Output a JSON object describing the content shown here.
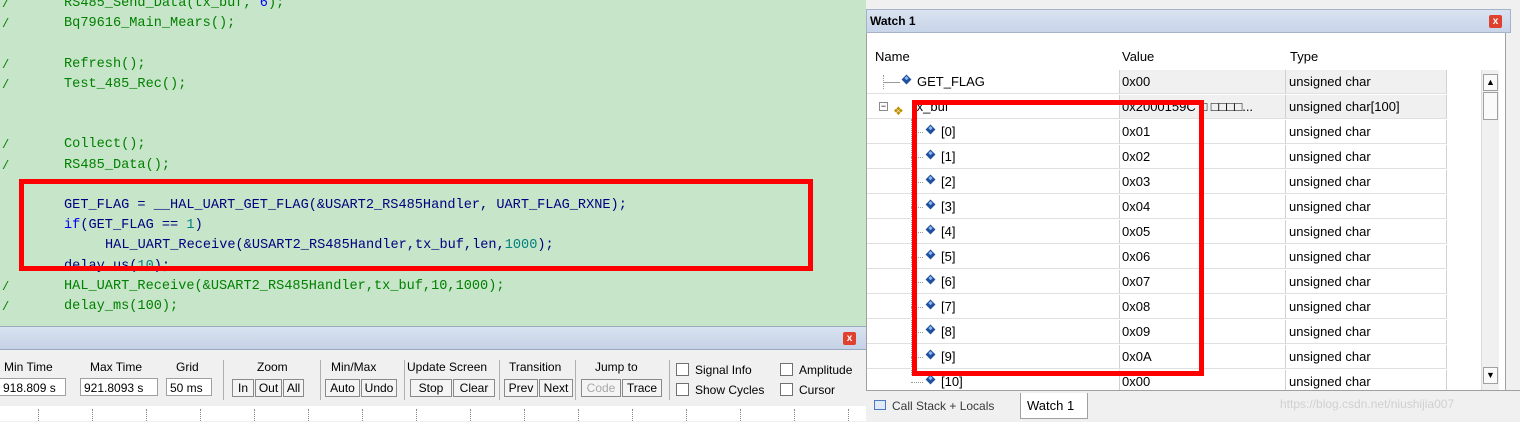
{
  "editor": {
    "lines": [
      {
        "mark": "/",
        "parts": [
          {
            "t": "RS485_Send_Data(tx_buf, "
          },
          {
            "t": "6",
            "c": "num"
          },
          {
            "t": ");"
          }
        ]
      },
      {
        "mark": "/",
        "parts": [
          {
            "t": "Bq79616_Main_Mears();"
          }
        ]
      },
      {
        "mark": "",
        "parts": []
      },
      {
        "mark": "/",
        "parts": [
          {
            "t": "Refresh();"
          }
        ]
      },
      {
        "mark": "/",
        "parts": [
          {
            "t": "Test_485_Rec();"
          }
        ]
      },
      {
        "mark": "",
        "parts": []
      },
      {
        "mark": "",
        "parts": []
      },
      {
        "mark": "/",
        "parts": [
          {
            "t": "Collect();"
          }
        ]
      },
      {
        "mark": "/",
        "parts": [
          {
            "t": "RS485_Data();"
          }
        ]
      },
      {
        "mark": "",
        "parts": []
      },
      {
        "mark": "",
        "active": true,
        "parts": [
          {
            "t": "GET_FLAG = __HAL_UART_GET_FLAG(&USART2_RS485Handler, UART_FLAG_RXNE);"
          }
        ]
      },
      {
        "mark": "",
        "active": true,
        "parts": [
          {
            "t": "if",
            "c": "kw"
          },
          {
            "t": "(GET_FLAG == "
          },
          {
            "t": "1",
            "c": "num"
          },
          {
            "t": ")"
          }
        ]
      },
      {
        "mark": "",
        "active": true,
        "indent": 1,
        "parts": [
          {
            "t": "HAL_UART_Receive(&USART2_RS485Handler,tx_buf,len,"
          },
          {
            "t": "1000",
            "c": "num"
          },
          {
            "t": ");"
          }
        ]
      },
      {
        "mark": "",
        "active": true,
        "parts": [
          {
            "t": "delay_us("
          },
          {
            "t": "10",
            "c": "num"
          },
          {
            "t": ");"
          }
        ]
      },
      {
        "mark": "/",
        "parts": [
          {
            "t": "HAL_UART_Receive(&USART2_RS485Handler,tx_buf,10,1000);"
          }
        ]
      },
      {
        "mark": "/",
        "parts": [
          {
            "t": "delay_ms(100);"
          }
        ]
      }
    ]
  },
  "analyzer": {
    "close_label": "x",
    "min_time": {
      "label": "Min Time",
      "value": "918.809 s"
    },
    "max_time": {
      "label": "Max Time",
      "value": "921.8093 s"
    },
    "grid": {
      "label": "Grid",
      "value": "50 ms"
    },
    "zoom": {
      "label": "Zoom",
      "buttons": [
        "In",
        "Out",
        "All"
      ]
    },
    "minmax": {
      "label": "Min/Max",
      "buttons": [
        "Auto",
        "Undo"
      ]
    },
    "update_screen": {
      "label": "Update Screen",
      "buttons": [
        "Stop",
        "Clear"
      ]
    },
    "transition": {
      "label": "Transition",
      "buttons": [
        "Prev",
        "Next"
      ]
    },
    "jump_to": {
      "label": "Jump to",
      "buttons": [
        "Code",
        "Trace"
      ]
    },
    "checkboxes": [
      "Signal Info",
      "Amplitude",
      "Show Cycles",
      "Cursor"
    ]
  },
  "watch": {
    "title": "Watch 1",
    "close_label": "x",
    "columns": {
      "name": "Name",
      "value": "Value",
      "type": "Type"
    },
    "rows": [
      {
        "name": "GET_FLAG",
        "value": "0x00",
        "type": "unsigned char",
        "level": 0
      },
      {
        "name": "tx_buf",
        "value": "0x2000159C □ □□□□...",
        "type": "unsigned char[100]",
        "level": 0,
        "expander": "−"
      },
      {
        "name": "[0]",
        "value": "0x01",
        "type": "unsigned char",
        "level": 1
      },
      {
        "name": "[1]",
        "value": "0x02",
        "type": "unsigned char",
        "level": 1
      },
      {
        "name": "[2]",
        "value": "0x03",
        "type": "unsigned char",
        "level": 1
      },
      {
        "name": "[3]",
        "value": "0x04",
        "type": "unsigned char",
        "level": 1
      },
      {
        "name": "[4]",
        "value": "0x05",
        "type": "unsigned char",
        "level": 1
      },
      {
        "name": "[5]",
        "value": "0x06",
        "type": "unsigned char",
        "level": 1
      },
      {
        "name": "[6]",
        "value": "0x07",
        "type": "unsigned char",
        "level": 1
      },
      {
        "name": "[7]",
        "value": "0x08",
        "type": "unsigned char",
        "level": 1
      },
      {
        "name": "[8]",
        "value": "0x09",
        "type": "unsigned char",
        "level": 1
      },
      {
        "name": "[9]",
        "value": "0x0A",
        "type": "unsigned char",
        "level": 1
      },
      {
        "name": "[10]",
        "value": "0x00",
        "type": "unsigned char",
        "level": 1
      }
    ],
    "tabs": [
      "Call Stack + Locals",
      "Watch 1"
    ],
    "watermark": "https://blog.csdn.net/niushijia007",
    "scroll_up": "▲",
    "scroll_down": "▼"
  },
  "colors": {
    "highlight": "#ff0000",
    "editor_bg": "#c7e5c8",
    "comment_green": "#008000"
  },
  "icons": {
    "variable": "variable-diamond-icon",
    "struct": "struct-icon",
    "tab": "window-icon"
  }
}
